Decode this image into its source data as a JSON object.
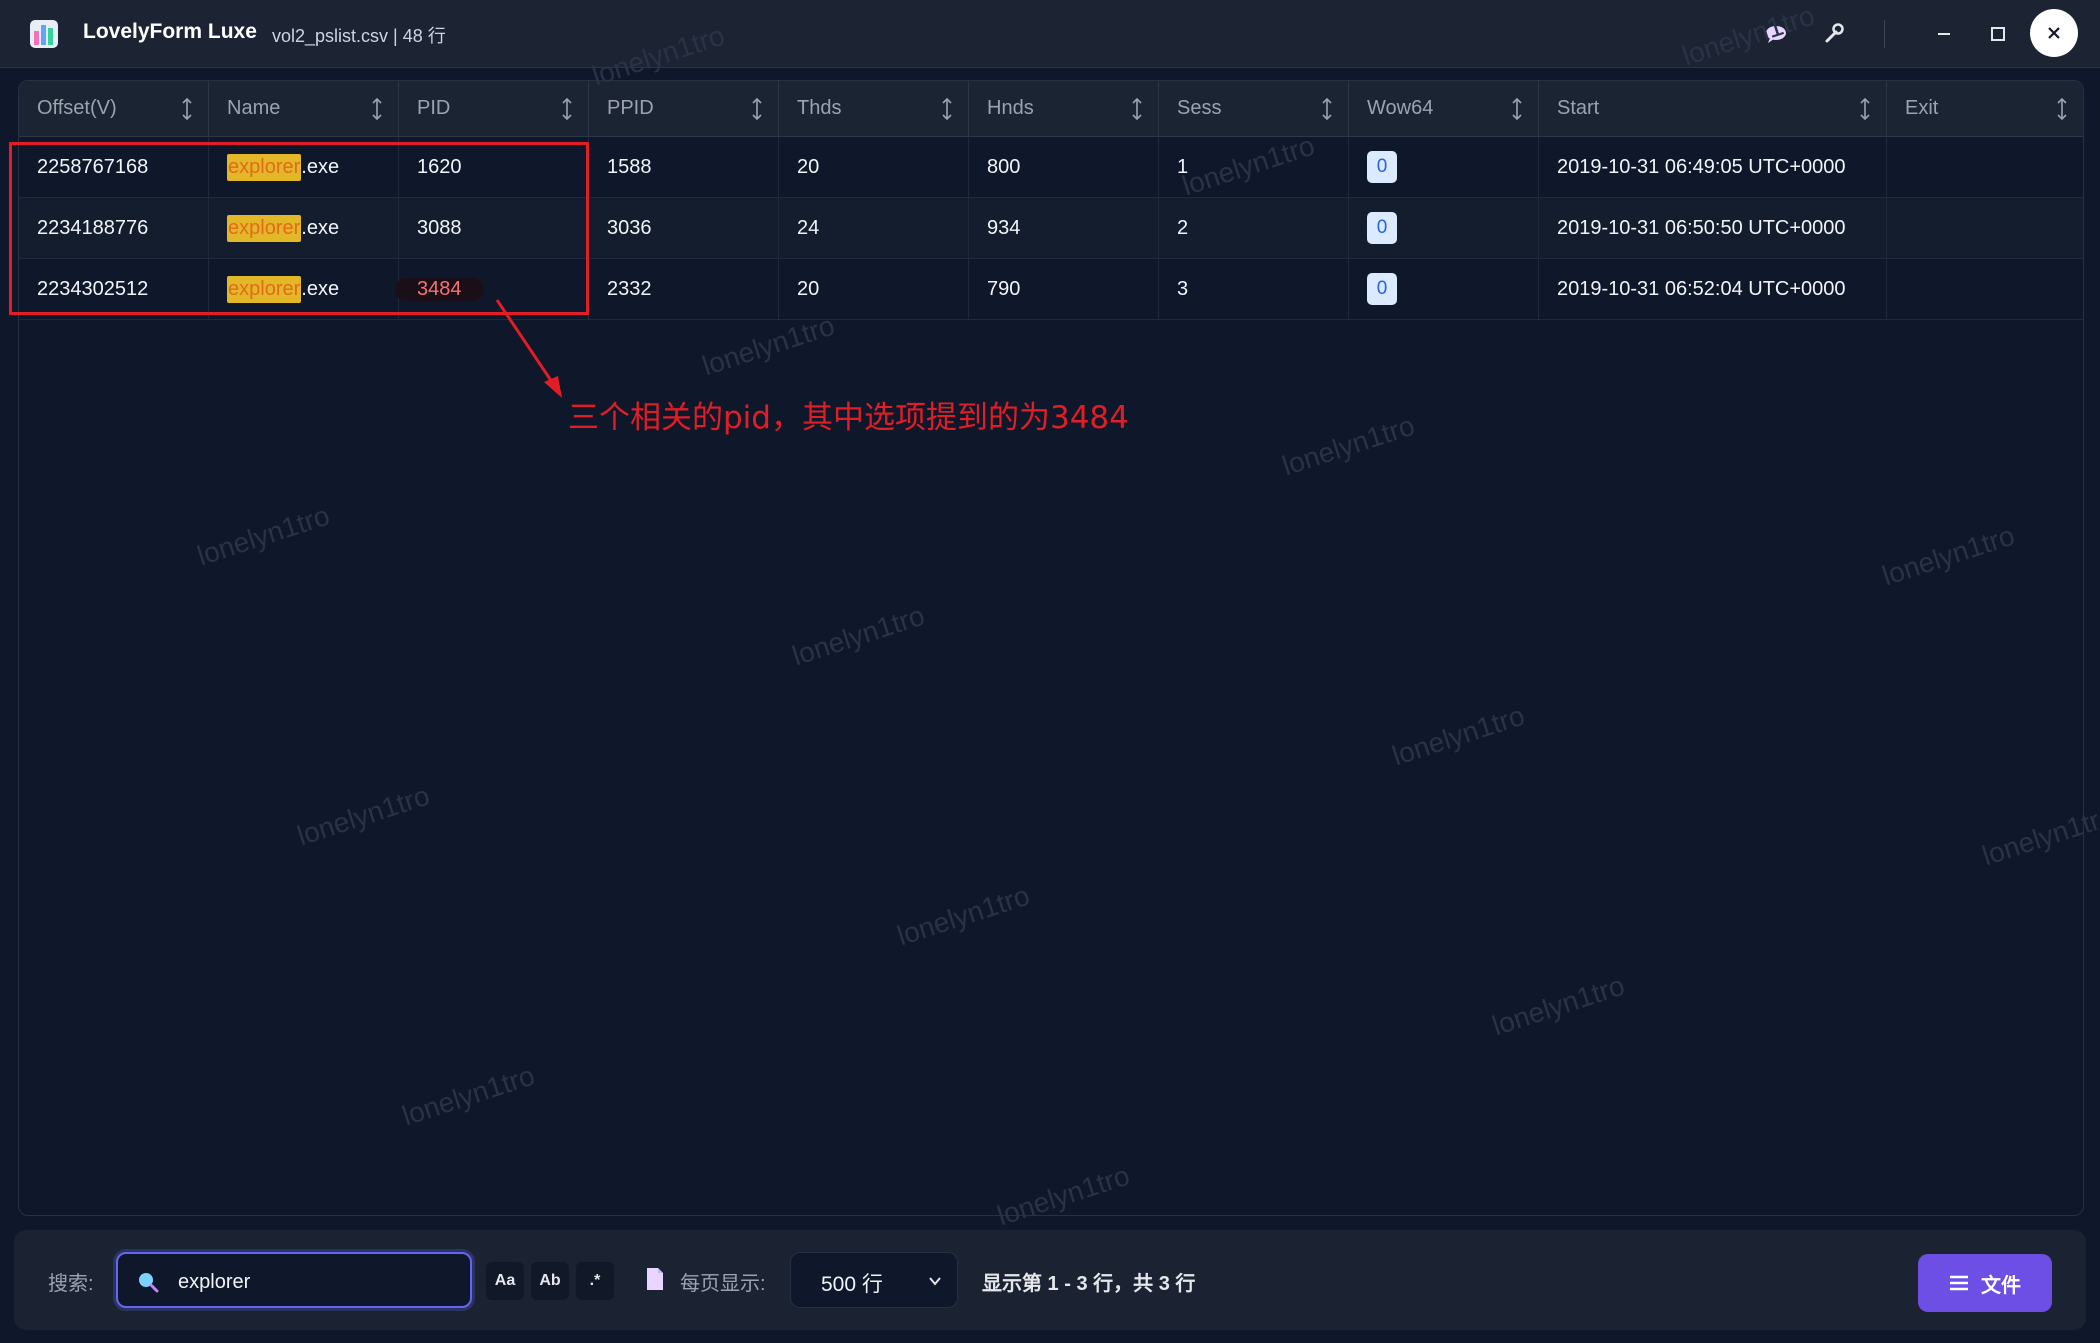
{
  "titlebar": {
    "app_name": "LovelyForm Luxe",
    "file_info": "vol2_pslist.csv | 48 行",
    "icons": [
      "chat-icon",
      "wrench-icon",
      "minimize-icon",
      "maximize-icon",
      "close-icon"
    ]
  },
  "table": {
    "columns": [
      "Offset(V)",
      "Name",
      "PID",
      "PPID",
      "Thds",
      "Hnds",
      "Sess",
      "Wow64",
      "Start",
      "Exit"
    ],
    "rows": [
      {
        "offset": "2258767168",
        "name_match": "explorer",
        "name_rest": ".exe",
        "pid": "1620",
        "ppid": "1588",
        "thds": "20",
        "hnds": "800",
        "sess": "1",
        "wow64": "0",
        "start": "2019-10-31 06:49:05 UTC+0000",
        "exit": ""
      },
      {
        "offset": "2234188776",
        "name_match": "explorer",
        "name_rest": ".exe",
        "pid": "3088",
        "ppid": "3036",
        "thds": "24",
        "hnds": "934",
        "sess": "2",
        "wow64": "0",
        "start": "2019-10-31 06:50:50 UTC+0000",
        "exit": ""
      },
      {
        "offset": "2234302512",
        "name_match": "explorer",
        "name_rest": ".exe",
        "pid": "3484",
        "ppid": "2332",
        "thds": "20",
        "hnds": "790",
        "sess": "3",
        "wow64": "0",
        "start": "2019-10-31 06:52:04 UTC+0000",
        "exit": ""
      }
    ]
  },
  "annotation": {
    "text": "三个相关的pid，其中选项提到的为3484",
    "color": "#e11d25"
  },
  "watermark": "lonelyn1tro",
  "bottombar": {
    "search_label": "搜索:",
    "search_value": "explorer",
    "options": [
      "Aa",
      "Ab",
      ".*"
    ],
    "per_page_label": "每页显示:",
    "per_page_value": "500 行",
    "status": "显示第 1 - 3 行，共 3 行",
    "file_button": "文件"
  },
  "colors": {
    "accent": "#6d4fe6",
    "highlight_bg": "#e2b829",
    "highlight_text": "#e46a1b",
    "selected_pid": "#f87171"
  }
}
